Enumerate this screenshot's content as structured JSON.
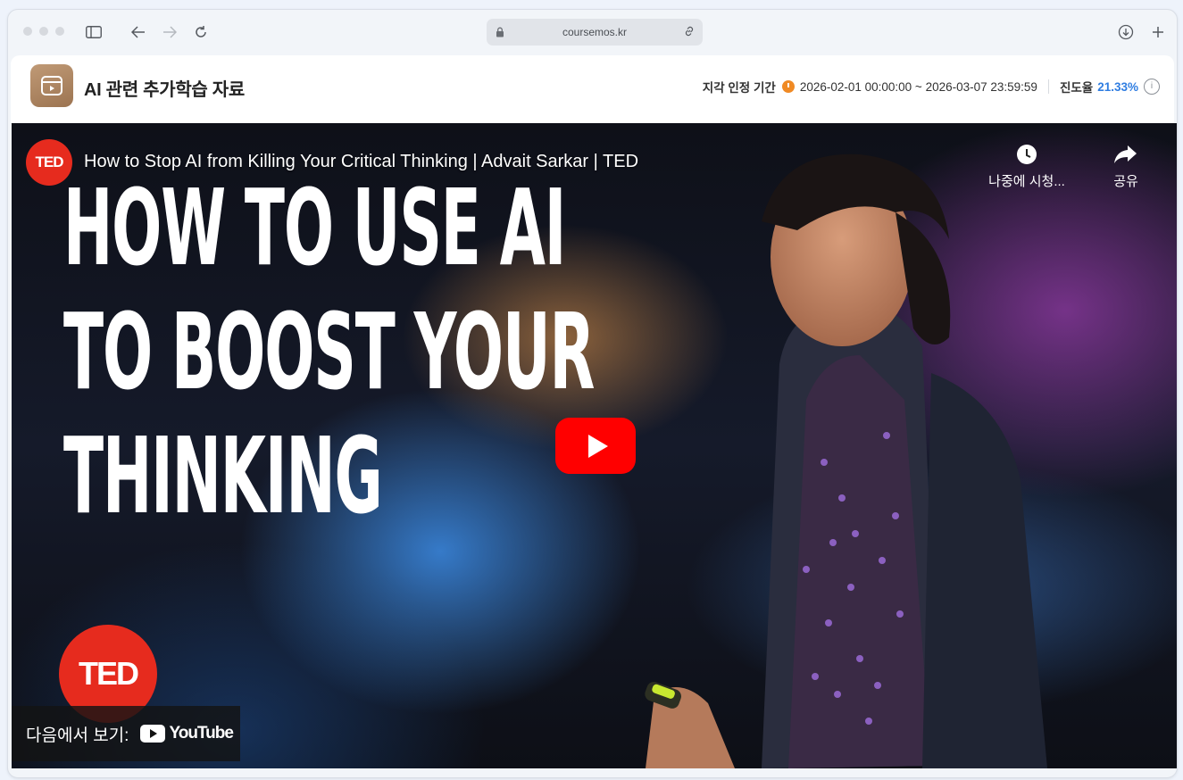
{
  "browser": {
    "url": "coursemos.kr",
    "icons": [
      "sidebar-icon",
      "back-arrow-icon",
      "forward-arrow-icon",
      "reload-icon",
      "lock-icon",
      "link-icon",
      "download-icon",
      "new-tab-plus-icon"
    ]
  },
  "header": {
    "title": "AI 관련 추가학습 자료",
    "late_label": "지각 인정 기간",
    "period": "2026-02-01 00:00:00 ~ 2026-03-07 23:59:59",
    "progress_label": "진도율",
    "progress_value": "21.33%",
    "progress_fraction": 0.2133,
    "accent_color": "#2f7de1",
    "clock_color": "#f08a24"
  },
  "video": {
    "channel_badge": "TED",
    "title": "How to Stop AI from Killing Your Critical Thinking | Advait Sarkar | TED",
    "thumbnail_text": [
      "HOW TO USE AI",
      "TO BOOST YOUR",
      "THINKING"
    ],
    "watch_later_label": "나중에 시청...",
    "share_label": "공유",
    "watch_on_label": "다음에서 보기:",
    "youtube_label": "YouTube",
    "ted_logo": "TED",
    "play_color": "#ff0000"
  }
}
